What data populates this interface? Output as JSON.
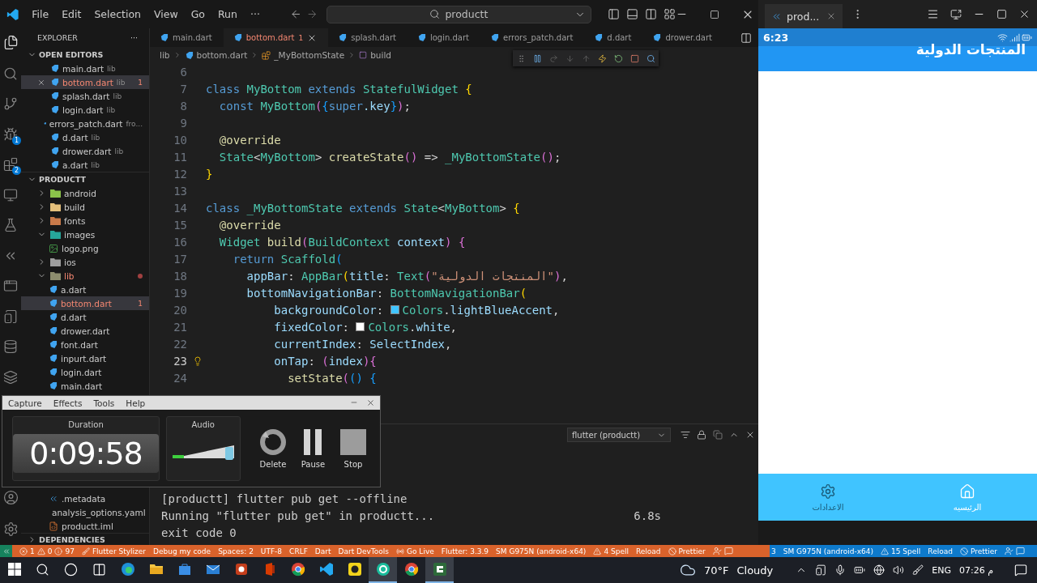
{
  "title_bar": {
    "menus": [
      "File",
      "Edit",
      "Selection",
      "View",
      "Go",
      "Run",
      "···"
    ],
    "search": {
      "value": "productt"
    }
  },
  "activity_bar": {
    "run_badge": "1",
    "extensions_badge": "2"
  },
  "explorer": {
    "title": "EXPLORER",
    "more": "···",
    "open_editors": {
      "label": "OPEN EDITORS",
      "expanded": true,
      "items": [
        {
          "name": "main.dart",
          "detail": "lib",
          "selected": false,
          "error": false
        },
        {
          "name": "bottom.dart",
          "detail": "lib",
          "selected": true,
          "error": true,
          "count": "1"
        },
        {
          "name": "splash.dart",
          "detail": "lib",
          "selected": false,
          "error": false
        },
        {
          "name": "login.dart",
          "detail": "lib",
          "selected": false,
          "error": false
        },
        {
          "name": "errors_patch.dart",
          "detail": "fro...",
          "selected": false,
          "error": false
        },
        {
          "name": "d.dart",
          "detail": "lib",
          "selected": false,
          "error": false
        },
        {
          "name": "drower.dart",
          "detail": "lib",
          "selected": false,
          "error": false
        },
        {
          "name": "a.dart",
          "detail": "lib",
          "selected": false,
          "error": false
        }
      ]
    },
    "project": {
      "label": "PRODUCTT",
      "expanded": true,
      "children": [
        {
          "name": "android",
          "kind": "folder",
          "color": "#8bc34a",
          "expanded": false,
          "selected": false,
          "error": false
        },
        {
          "name": "build",
          "kind": "folder",
          "color": "#e5c07b",
          "expanded": false,
          "selected": false,
          "error": false
        },
        {
          "name": "fonts",
          "kind": "folder",
          "color": "#c97a4a",
          "expanded": false,
          "selected": false,
          "error": false
        },
        {
          "name": "images",
          "kind": "folder",
          "color": "#26a69a",
          "expanded": true,
          "selected": false,
          "error": false,
          "children": [
            {
              "name": "logo.png",
              "kind": "image",
              "selected": false,
              "error": false
            }
          ]
        },
        {
          "name": "ios",
          "kind": "folder",
          "color": "#9e9e9e",
          "expanded": false,
          "selected": false,
          "error": false
        },
        {
          "name": "lib",
          "kind": "folder",
          "color": "#8d8d6e",
          "expanded": true,
          "selected": false,
          "error": true,
          "children": [
            {
              "name": "a.dart",
              "kind": "dart",
              "selected": false,
              "error": false
            },
            {
              "name": "bottom.dart",
              "kind": "dart",
              "selected": true,
              "error": true,
              "count": "1"
            },
            {
              "name": "d.dart",
              "kind": "dart",
              "selected": false,
              "error": false
            },
            {
              "name": "drower.dart",
              "kind": "dart",
              "selected": false,
              "error": false
            },
            {
              "name": "font.dart",
              "kind": "dart",
              "selected": false,
              "error": false
            },
            {
              "name": "inpurt.dart",
              "kind": "dart",
              "selected": false,
              "error": false
            },
            {
              "name": "login.dart",
              "kind": "dart",
              "selected": false,
              "error": false
            },
            {
              "name": "main.dart",
              "kind": "dart",
              "selected": false,
              "error": false
            }
          ]
        }
      ]
    },
    "project_bottom": [
      {
        "name": ".metadata",
        "kind": "flutter",
        "selected": false,
        "error": false
      },
      {
        "name": "analysis_options.yaml",
        "kind": "yaml",
        "selected": false,
        "error": false
      },
      {
        "name": "productt.iml",
        "kind": "xml",
        "selected": false,
        "error": false
      }
    ],
    "dependencies": {
      "label": "DEPENDENCIES",
      "expanded": false
    }
  },
  "editor": {
    "tabs": [
      {
        "name": "main.dart",
        "selected": false,
        "error": false
      },
      {
        "name": "bottom.dart",
        "selected": true,
        "error": true,
        "count": "1"
      },
      {
        "name": "splash.dart",
        "selected": false,
        "error": false
      },
      {
        "name": "login.dart",
        "selected": false,
        "error": false
      },
      {
        "name": "errors_patch.dart",
        "selected": false,
        "error": false
      },
      {
        "name": "d.dart",
        "selected": false,
        "error": false
      },
      {
        "name": "drower.dart",
        "selected": false,
        "error": false
      }
    ],
    "breadcrumb": [
      "lib",
      "bottom.dart",
      "_MyBottomState",
      "build"
    ],
    "lines": [
      {
        "number": "6",
        "active": false,
        "lightbulb": false
      },
      {
        "number": "7",
        "active": false,
        "lightbulb": false,
        "tokens": [
          {
            "kind": "kw",
            "text": "class "
          },
          {
            "kind": "cls",
            "text": "MyBottom "
          },
          {
            "kind": "kw",
            "text": "extends "
          },
          {
            "kind": "cls",
            "text": "StatefulWidget "
          },
          {
            "kind": "b1",
            "text": "{"
          }
        ]
      },
      {
        "number": "8",
        "active": false,
        "lightbulb": false,
        "tokens": [
          {
            "kind": "kw",
            "text": "  const "
          },
          {
            "kind": "cls",
            "text": "MyBottom"
          },
          {
            "kind": "b2",
            "text": "("
          },
          {
            "kind": "b3",
            "text": "{"
          },
          {
            "kind": "kw",
            "text": "super"
          },
          {
            "kind": "prop",
            "text": ".key"
          },
          {
            "kind": "b3",
            "text": "}"
          },
          {
            "kind": "b2",
            "text": ")"
          },
          {
            "kind": "p",
            "text": ";"
          }
        ]
      },
      {
        "number": "9",
        "active": false,
        "lightbulb": false
      },
      {
        "number": "10",
        "active": false,
        "lightbulb": false,
        "tokens": [
          {
            "kind": "ann",
            "text": "  @override"
          }
        ]
      },
      {
        "number": "11",
        "active": false,
        "lightbulb": false,
        "tokens": [
          {
            "kind": "cls",
            "text": "  State"
          },
          {
            "kind": "p",
            "text": "<"
          },
          {
            "kind": "cls",
            "text": "MyBottom"
          },
          {
            "kind": "p",
            "text": "> "
          },
          {
            "kind": "fn",
            "text": "createState"
          },
          {
            "kind": "b2",
            "text": "()"
          },
          {
            "kind": "p",
            "text": " => "
          },
          {
            "kind": "cls",
            "text": "_MyBottomState"
          },
          {
            "kind": "b2",
            "text": "()"
          },
          {
            "kind": "p",
            "text": ";"
          }
        ]
      },
      {
        "number": "12",
        "active": false,
        "lightbulb": false,
        "tokens": [
          {
            "kind": "b1",
            "text": "}"
          }
        ]
      },
      {
        "number": "13",
        "active": false,
        "lightbulb": false
      },
      {
        "number": "14",
        "active": false,
        "lightbulb": false,
        "tokens": [
          {
            "kind": "kw",
            "text": "class "
          },
          {
            "kind": "cls",
            "text": "_MyBottomState "
          },
          {
            "kind": "kw",
            "text": "extends "
          },
          {
            "kind": "cls",
            "text": "State"
          },
          {
            "kind": "p",
            "text": "<"
          },
          {
            "kind": "cls",
            "text": "MyBottom"
          },
          {
            "kind": "p",
            "text": "> "
          },
          {
            "kind": "b1",
            "text": "{"
          }
        ]
      },
      {
        "number": "15",
        "active": false,
        "lightbulb": false,
        "tokens": [
          {
            "kind": "ann",
            "text": "  @override"
          }
        ]
      },
      {
        "number": "16",
        "active": false,
        "lightbulb": false,
        "tokens": [
          {
            "kind": "cls",
            "text": "  Widget "
          },
          {
            "kind": "fn",
            "text": "build"
          },
          {
            "kind": "b2",
            "text": "("
          },
          {
            "kind": "cls",
            "text": "BuildContext "
          },
          {
            "kind": "prop",
            "text": "context"
          },
          {
            "kind": "b2",
            "text": ") {"
          }
        ]
      },
      {
        "number": "17",
        "active": false,
        "lightbulb": false,
        "tokens": [
          {
            "kind": "kw",
            "text": "    return "
          },
          {
            "kind": "cls",
            "text": "Scaffold"
          },
          {
            "kind": "b3",
            "text": "("
          }
        ]
      },
      {
        "number": "18",
        "active": false,
        "lightbulb": false,
        "tokens": [
          {
            "kind": "prop",
            "text": "      appBar"
          },
          {
            "kind": "p",
            "text": ": "
          },
          {
            "kind": "cls",
            "text": "AppBar"
          },
          {
            "kind": "b1",
            "text": "("
          },
          {
            "kind": "prop",
            "text": "title"
          },
          {
            "kind": "p",
            "text": ": "
          },
          {
            "kind": "cls",
            "text": "Text"
          },
          {
            "kind": "b2",
            "text": "("
          },
          {
            "kind": "str",
            "text": "\"المنتجات الدولية\""
          },
          {
            "kind": "b2",
            "text": ")"
          },
          {
            "kind": "p",
            "text": ","
          }
        ]
      },
      {
        "number": "19",
        "active": false,
        "lightbulb": false,
        "tokens": [
          {
            "kind": "prop",
            "text": "      bottomNavigationBar"
          },
          {
            "kind": "p",
            "text": ": "
          },
          {
            "kind": "cls",
            "text": "BottomNavigationBar"
          },
          {
            "kind": "b1",
            "text": "("
          }
        ]
      },
      {
        "number": "20",
        "active": false,
        "lightbulb": false,
        "tokens": [
          {
            "kind": "prop",
            "text": "          backgroundColor"
          },
          {
            "kind": "p",
            "text": ": "
          },
          {
            "kind": "swatch",
            "color": "#40c4ff"
          },
          {
            "kind": "cls",
            "text": "Colors"
          },
          {
            "kind": "p",
            "text": "."
          },
          {
            "kind": "prop",
            "text": "lightBlueAccent"
          },
          {
            "kind": "p",
            "text": ","
          }
        ]
      },
      {
        "number": "21",
        "active": false,
        "lightbulb": false,
        "tokens": [
          {
            "kind": "prop",
            "text": "          fixedColor"
          },
          {
            "kind": "p",
            "text": ": "
          },
          {
            "kind": "swatch",
            "color": "#ffffff"
          },
          {
            "kind": "cls",
            "text": "Colors"
          },
          {
            "kind": "p",
            "text": "."
          },
          {
            "kind": "prop",
            "text": "white"
          },
          {
            "kind": "p",
            "text": ","
          }
        ]
      },
      {
        "number": "22",
        "active": false,
        "lightbulb": false,
        "tokens": [
          {
            "kind": "prop",
            "text": "          currentIndex"
          },
          {
            "kind": "p",
            "text": ": "
          },
          {
            "kind": "prop",
            "text": "SelectIndex"
          },
          {
            "kind": "p",
            "text": ","
          }
        ]
      },
      {
        "number": "23",
        "active": true,
        "lightbulb": true,
        "tokens": [
          {
            "kind": "prop",
            "text": "          onTap"
          },
          {
            "kind": "p",
            "text": ": "
          },
          {
            "kind": "b2",
            "text": "("
          },
          {
            "kind": "prop",
            "text": "index"
          },
          {
            "kind": "b2",
            "text": ")"
          },
          {
            "kind": "b2",
            "text": "{"
          }
        ]
      },
      {
        "number": "24",
        "active": false,
        "lightbulb": false,
        "tokens": [
          {
            "kind": "fn",
            "text": "            setState"
          },
          {
            "kind": "b2",
            "text": "("
          },
          {
            "kind": "b3",
            "text": "() {"
          }
        ]
      }
    ]
  },
  "terminal": {
    "selector": "flutter (productt)",
    "lines": [
      {
        "text": "[productt] flutter pub get --offline"
      },
      {
        "text": "Running \"flutter pub get\" in productt...",
        "time": "6.8s"
      },
      {
        "text": "exit code 0"
      }
    ]
  },
  "recorder": {
    "menus": [
      "Capture",
      "Effects",
      "Tools",
      "Help"
    ],
    "duration_label": "Duration",
    "duration": "0:09:58",
    "audio_label": "Audio",
    "audio": {
      "level": 0.93
    },
    "buttons": [
      {
        "kind": "delete",
        "label": "Delete"
      },
      {
        "kind": "pause",
        "label": "Pause"
      },
      {
        "kind": "stop",
        "label": "Stop"
      }
    ]
  },
  "emulator": {
    "tab": "prod...",
    "time": "6:23",
    "app_title": "المنتجات الدولية",
    "nav": [
      {
        "kind": "home",
        "label": "الرئيسيه",
        "selected": true
      },
      {
        "kind": "settings",
        "label": "الاعدادات",
        "selected": false
      }
    ]
  },
  "status_bar": {
    "left": [
      {
        "kind": "remote"
      },
      {
        "kind": "problems",
        "errors": "1",
        "warnings": "0",
        "infos": "97"
      },
      {
        "kind": "stylizer",
        "text": "Flutter Stylizer"
      },
      {
        "kind": "text",
        "text": "Debug my code"
      },
      {
        "kind": "text",
        "text": "Spaces: 2"
      },
      {
        "kind": "text",
        "text": "UTF-8"
      },
      {
        "kind": "text",
        "text": "CRLF"
      },
      {
        "kind": "text",
        "text": "Dart"
      },
      {
        "kind": "text",
        "text": "Dart DevTools"
      },
      {
        "kind": "live",
        "text": "Go Live"
      },
      {
        "kind": "text",
        "text": "Flutter: 3.3.9"
      },
      {
        "kind": "text",
        "text": "SM G975N (android-x64)"
      },
      {
        "kind": "spell",
        "text": "4 Spell"
      },
      {
        "kind": "text",
        "text": "Reload"
      },
      {
        "kind": "prettier",
        "text": "Prettier"
      },
      {
        "kind": "icons"
      }
    ],
    "right": [
      {
        "kind": "text",
        "text": "3"
      },
      {
        "kind": "text",
        "text": "SM G975N (android-x64)"
      },
      {
        "kind": "spell",
        "text": "15 Spell"
      },
      {
        "kind": "text",
        "text": "Reload"
      },
      {
        "kind": "prettier",
        "text": "Prettier"
      },
      {
        "kind": "icons"
      }
    ]
  },
  "taskbar": {
    "apps": [
      {
        "kind": "edge",
        "active": false
      },
      {
        "kind": "files",
        "active": false
      },
      {
        "kind": "store",
        "active": false
      },
      {
        "kind": "mail",
        "active": false
      },
      {
        "kind": "slides",
        "active": false
      },
      {
        "kind": "office",
        "active": false
      },
      {
        "kind": "chrome",
        "active": false
      },
      {
        "kind": "code",
        "active": false
      },
      {
        "kind": "yellow",
        "active": false
      },
      {
        "kind": "green",
        "active": true
      },
      {
        "kind": "chrome",
        "active": false
      },
      {
        "kind": "capture",
        "active": true
      }
    ],
    "temperature": "70°F",
    "weather": "Cloudy",
    "language": "ENG",
    "time": "07:26 م"
  }
}
